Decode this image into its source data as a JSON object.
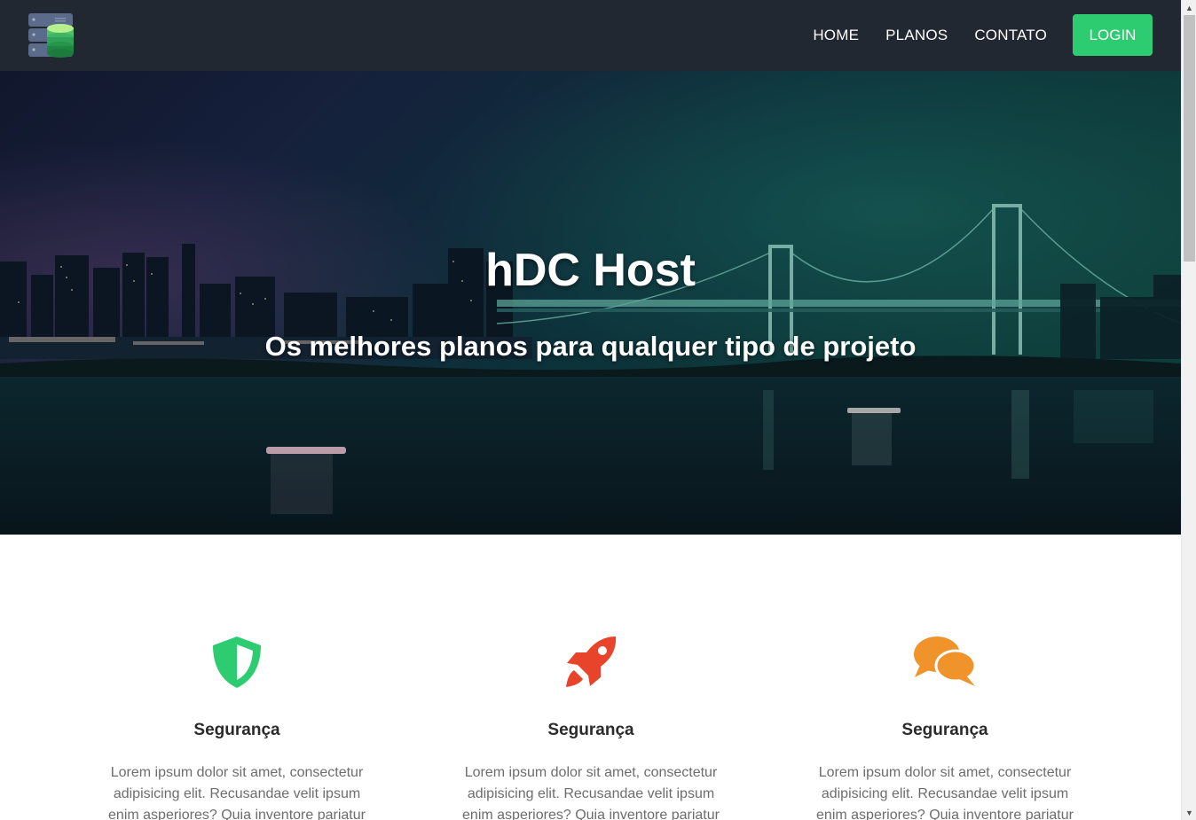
{
  "nav": {
    "logo_icon": "server-database-icon",
    "links": [
      "HOME",
      "PLANOS",
      "CONTATO"
    ],
    "login_label": "LOGIN"
  },
  "hero": {
    "title": "hDC Host",
    "subtitle": "Os melhores planos para qualquer tipo de projeto"
  },
  "features": [
    {
      "icon": "shield-icon",
      "icon_color": "#2ecc71",
      "title": "Segurança",
      "text": "Lorem ipsum dolor sit amet, consectetur adipisicing elit. Recusandae velit ipsum enim asperiores? Quia inventore pariatur ab quasi"
    },
    {
      "icon": "rocket-icon",
      "icon_color": "#e8442b",
      "title": "Segurança",
      "text": "Lorem ipsum dolor sit amet, consectetur adipisicing elit. Recusandae velit ipsum enim asperiores? Quia inventore pariatur ab quasi"
    },
    {
      "icon": "chat-bubbles-icon",
      "icon_color": "#f0932b",
      "title": "Segurança",
      "text": "Lorem ipsum dolor sit amet, consectetur adipisicing elit. Recusandae velit ipsum enim asperiores? Quia inventore pariatur ab quasi"
    }
  ],
  "colors": {
    "navbar_bg": "#222831",
    "accent": "#2ecc71"
  }
}
